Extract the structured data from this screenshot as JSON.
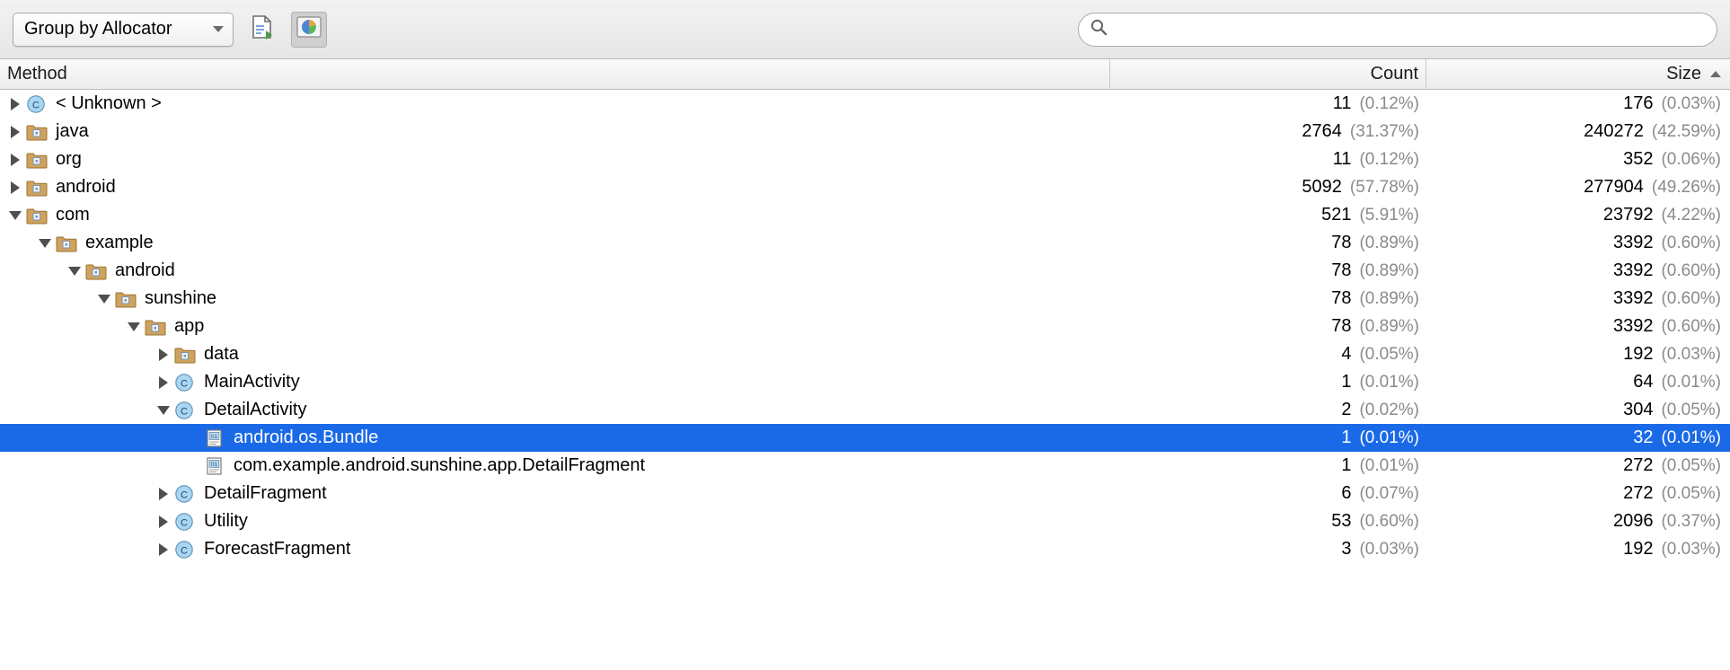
{
  "toolbar": {
    "group_by": "Group by Allocator",
    "export_icon": "export-document-icon",
    "chart_icon": "pie-chart-icon",
    "search_icon": "search-icon",
    "search_value": "",
    "search_placeholder": ""
  },
  "columns": {
    "method": "Method",
    "count": "Count",
    "size": "Size",
    "sorted_by": "Size"
  },
  "rows": [
    {
      "indent": 0,
      "twisty": "right",
      "icon": "class-icon",
      "label": "< Unknown >",
      "count": "11",
      "count_pct": "(0.12%)",
      "size": "176",
      "size_pct": "(0.03%)",
      "selected": false
    },
    {
      "indent": 0,
      "twisty": "right",
      "icon": "package-icon",
      "label": "java",
      "count": "2764",
      "count_pct": "(31.37%)",
      "size": "240272",
      "size_pct": "(42.59%)",
      "selected": false
    },
    {
      "indent": 0,
      "twisty": "right",
      "icon": "package-icon",
      "label": "org",
      "count": "11",
      "count_pct": "(0.12%)",
      "size": "352",
      "size_pct": "(0.06%)",
      "selected": false
    },
    {
      "indent": 0,
      "twisty": "right",
      "icon": "package-icon",
      "label": "android",
      "count": "5092",
      "count_pct": "(57.78%)",
      "size": "277904",
      "size_pct": "(49.26%)",
      "selected": false
    },
    {
      "indent": 0,
      "twisty": "down",
      "icon": "package-icon",
      "label": "com",
      "count": "521",
      "count_pct": "(5.91%)",
      "size": "23792",
      "size_pct": "(4.22%)",
      "selected": false
    },
    {
      "indent": 1,
      "twisty": "down",
      "icon": "package-icon",
      "label": "example",
      "count": "78",
      "count_pct": "(0.89%)",
      "size": "3392",
      "size_pct": "(0.60%)",
      "selected": false
    },
    {
      "indent": 2,
      "twisty": "down",
      "icon": "package-icon",
      "label": "android",
      "count": "78",
      "count_pct": "(0.89%)",
      "size": "3392",
      "size_pct": "(0.60%)",
      "selected": false
    },
    {
      "indent": 3,
      "twisty": "down",
      "icon": "package-icon",
      "label": "sunshine",
      "count": "78",
      "count_pct": "(0.89%)",
      "size": "3392",
      "size_pct": "(0.60%)",
      "selected": false
    },
    {
      "indent": 4,
      "twisty": "down",
      "icon": "package-icon",
      "label": "app",
      "count": "78",
      "count_pct": "(0.89%)",
      "size": "3392",
      "size_pct": "(0.60%)",
      "selected": false
    },
    {
      "indent": 5,
      "twisty": "right",
      "icon": "package-icon",
      "label": "data",
      "count": "4",
      "count_pct": "(0.05%)",
      "size": "192",
      "size_pct": "(0.03%)",
      "selected": false
    },
    {
      "indent": 5,
      "twisty": "right",
      "icon": "class-icon",
      "label": "MainActivity",
      "count": "1",
      "count_pct": "(0.01%)",
      "size": "64",
      "size_pct": "(0.01%)",
      "selected": false
    },
    {
      "indent": 5,
      "twisty": "down",
      "icon": "class-icon",
      "label": "DetailActivity",
      "count": "2",
      "count_pct": "(0.02%)",
      "size": "304",
      "size_pct": "(0.05%)",
      "selected": false
    },
    {
      "indent": 6,
      "twisty": "none",
      "icon": "instance-icon",
      "label": "android.os.Bundle",
      "count": "1",
      "count_pct": "(0.01%)",
      "size": "32",
      "size_pct": "(0.01%)",
      "selected": true
    },
    {
      "indent": 6,
      "twisty": "none",
      "icon": "instance-icon",
      "label": "com.example.android.sunshine.app.DetailFragment",
      "count": "1",
      "count_pct": "(0.01%)",
      "size": "272",
      "size_pct": "(0.05%)",
      "selected": false
    },
    {
      "indent": 5,
      "twisty": "right",
      "icon": "class-icon",
      "label": "DetailFragment",
      "count": "6",
      "count_pct": "(0.07%)",
      "size": "272",
      "size_pct": "(0.05%)",
      "selected": false
    },
    {
      "indent": 5,
      "twisty": "right",
      "icon": "class-icon",
      "label": "Utility",
      "count": "53",
      "count_pct": "(0.60%)",
      "size": "2096",
      "size_pct": "(0.37%)",
      "selected": false
    },
    {
      "indent": 5,
      "twisty": "right",
      "icon": "class-icon",
      "label": "ForecastFragment",
      "count": "3",
      "count_pct": "(0.03%)",
      "size": "192",
      "size_pct": "(0.03%)",
      "selected": false
    }
  ],
  "colors": {
    "selection": "#1a6ae8",
    "folder": "#c9a05c",
    "class_badge": "#a8d4f0",
    "percent_text": "#8a8a8a"
  }
}
